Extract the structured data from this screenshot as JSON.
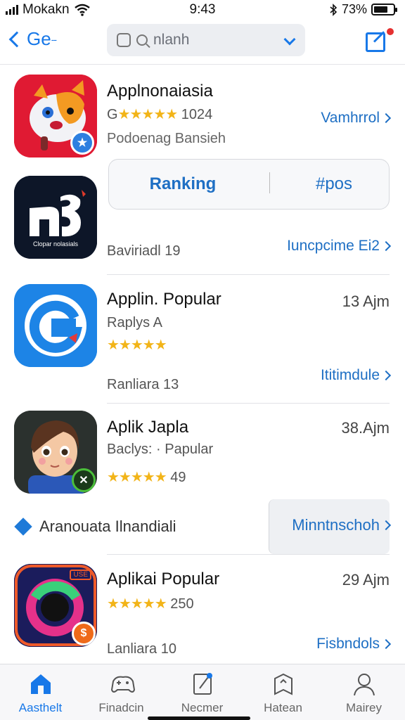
{
  "status_bar": {
    "carrier": "Mokakn",
    "time": "9:43",
    "battery_percent": "73%",
    "battery_level": 0.73
  },
  "nav": {
    "back_label": "Ge",
    "search_text": "nlanh"
  },
  "apps": [
    {
      "title": "Applnonaiasia",
      "rating_text": "1024",
      "rating_prefix": "G",
      "subtitle": "Podoenag Bansieh",
      "action": "Vamhrrol"
    },
    {
      "bottom_text": "Baviriadl 19",
      "action": "Iuncpcime Ei2",
      "icon_text": "Clopar nolasials"
    },
    {
      "title": "Applin. Popular",
      "meta": "Raplys A",
      "time": "13 Ajm",
      "bottom_text": "Ranliara 13",
      "action": "Ititimdule"
    },
    {
      "title": "Aplik Japla",
      "meta": "Baclys: · Papular",
      "rating_text": "49",
      "time": "38.Ajm"
    },
    {
      "title": "Aplikai Popular",
      "rating_text": "250",
      "time": "29 Ajm",
      "bottom_text": "Lanliara 10",
      "action": "Fisbndols",
      "badge_text": "USE"
    }
  ],
  "segment": {
    "left": "Ranking",
    "right": "#pos"
  },
  "banner": {
    "text": "Aranouata Ilnandiali",
    "button": "Minntnschoh"
  },
  "tabs": [
    {
      "label": "Aasthelt",
      "icon": "home-icon"
    },
    {
      "label": "Finadcin",
      "icon": "gamepad-icon"
    },
    {
      "label": "Necmer",
      "icon": "document-icon"
    },
    {
      "label": "Hatean",
      "icon": "tag-icon"
    },
    {
      "label": "Mairey",
      "icon": "person-icon"
    }
  ],
  "colors": {
    "accent": "#1878e8",
    "link": "#1e6fc4",
    "star": "#f2b418",
    "notification": "#e53030"
  }
}
